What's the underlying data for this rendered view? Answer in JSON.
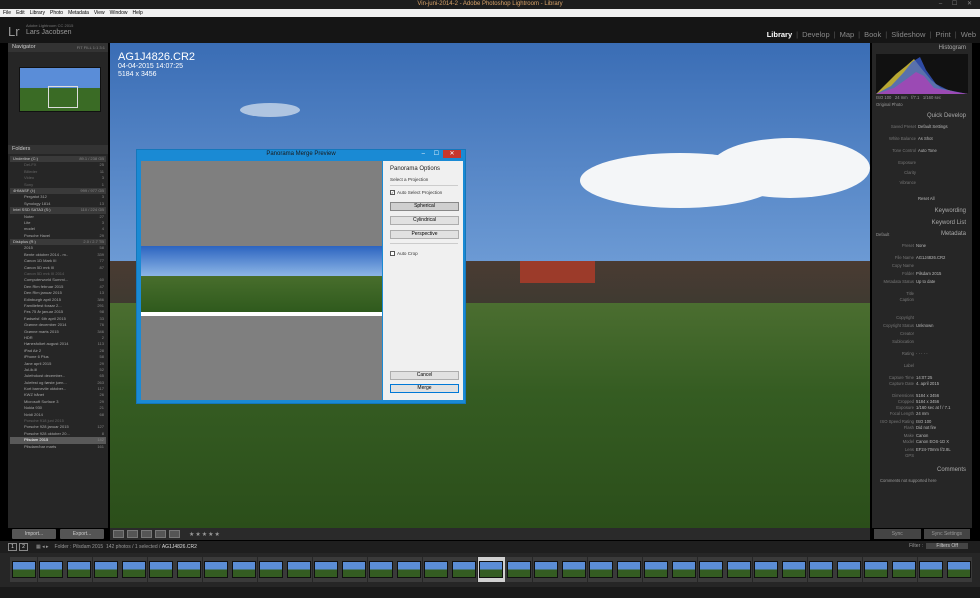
{
  "window": {
    "title": "Vin-juni-2014-2 - Adobe Photoshop Lightroom - Library",
    "controls": "– ☐ ✕"
  },
  "menubar": [
    "File",
    "Edit",
    "Library",
    "Photo",
    "Metadata",
    "View",
    "Window",
    "Help"
  ],
  "identity": {
    "logo": "Lr",
    "catalog": "Adobe Lightroom CC 2015",
    "user": "Lars Jacobsen"
  },
  "modules": [
    "Library",
    "Develop",
    "Map",
    "Book",
    "Slideshow",
    "Print",
    "Web"
  ],
  "active_module": "Library",
  "left": {
    "navigator": {
      "label": "Navigator",
      "zoom": "FIT FILL 1:1 3:1"
    },
    "folders": {
      "label": "Folders"
    },
    "items": [
      {
        "t": "vol",
        "label": "Underline (C:)",
        "n": "89.1 / 238 GB"
      },
      {
        "t": "dim",
        "label": "Del-FX",
        "n": "25"
      },
      {
        "t": "dim",
        "label": "Billeder",
        "n": "11"
      },
      {
        "t": "dim",
        "label": "Video",
        "n": "3"
      },
      {
        "t": "dim",
        "label": "Sony",
        "n": "1"
      },
      {
        "t": "vol",
        "label": "4HMASF (I:)",
        "n": "999 / 977 GB"
      },
      {
        "t": "",
        "label": "Pergatot 312",
        "n": "3"
      },
      {
        "t": "",
        "label": "Synology 1814",
        "n": "13"
      },
      {
        "t": "vol",
        "label": "Intel SSD SATA3 (S:)",
        "n": "110 / 224 GB"
      },
      {
        "t": "",
        "label": "Noter",
        "n": "27"
      },
      {
        "t": "",
        "label": "Lite",
        "n": "3"
      },
      {
        "t": "",
        "label": "model",
        "n": "4"
      },
      {
        "t": "",
        "label": "Porsche Havel",
        "n": "29"
      },
      {
        "t": "vol",
        "label": "Diskplus (R:)",
        "n": "2.0 / 2.7 TB"
      },
      {
        "t": "",
        "label": "2015",
        "n": "58"
      },
      {
        "t": "",
        "label": "Bente oktober 2014 - m..",
        "n": "339"
      },
      {
        "t": "",
        "label": "Canon 1D Mark III",
        "n": "77"
      },
      {
        "t": "",
        "label": "Canon 5D mrk III",
        "n": "87"
      },
      {
        "t": "dim",
        "label": "Canon 5D mrk III 2014",
        "n": ""
      },
      {
        "t": "",
        "label": "Computerworld Summi...",
        "n": "60"
      },
      {
        "t": "",
        "label": "Den Rim februar 2015",
        "n": "47"
      },
      {
        "t": "",
        "label": "Den Rim januar 2015",
        "n": "13"
      },
      {
        "t": "",
        "label": "Edinburgh april 2015",
        "n": "386"
      },
      {
        "t": "",
        "label": "Familiefest foraar 2...",
        "n": "291"
      },
      {
        "t": "",
        "label": "Fes 75 år januar 2015",
        "n": "98"
      },
      {
        "t": "",
        "label": "Fødselsf. 6th april 2015",
        "n": "33"
      },
      {
        "t": "",
        "label": "Grønne december 2014",
        "n": "76"
      },
      {
        "t": "",
        "label": "Grønne marts 2015",
        "n": "346"
      },
      {
        "t": "",
        "label": "HDR",
        "n": "2"
      },
      {
        "t": "",
        "label": "Hønesfolket august 2014",
        "n": "113"
      },
      {
        "t": "",
        "label": "iPad Air 2",
        "n": "28"
      },
      {
        "t": "",
        "label": "iPhone 6 Plus",
        "n": "58"
      },
      {
        "t": "",
        "label": "Jane april 2015",
        "n": "29"
      },
      {
        "t": "",
        "label": "Jul-ik.lil",
        "n": "52"
      },
      {
        "t": "",
        "label": "Julefrokost december...",
        "n": "65"
      },
      {
        "t": "",
        "label": "Julefest og første juen...",
        "n": "263"
      },
      {
        "t": "",
        "label": "Kort barnevile oktober...",
        "n": "117"
      },
      {
        "t": "",
        "label": "KWZ hånet",
        "n": "26"
      },
      {
        "t": "",
        "label": "Microsoft Surface 3",
        "n": "29"
      },
      {
        "t": "",
        "label": "Nokia 930",
        "n": "21"
      },
      {
        "t": "",
        "label": "Nvidi 2014",
        "n": "68"
      },
      {
        "t": "dim",
        "label": "Porsche 918 juni 2015",
        "n": ""
      },
      {
        "t": "",
        "label": "Porsche 928 januar 2015",
        "n": "127"
      },
      {
        "t": "",
        "label": "Porsche 928 oktober 20...",
        "n": "8"
      },
      {
        "t": "sel",
        "label": "Pilsdam 2015",
        "n": "142"
      },
      {
        "t": "",
        "label": "Pilsdam/bar marts",
        "n": "161"
      }
    ],
    "import_label": "Import...",
    "export_label": "Export..."
  },
  "photo_info": {
    "filename": "AG1J4826.CR2",
    "datetime": "04-04-2015 14:07:25",
    "dimensions": "5184 x 3456"
  },
  "toolbar": {
    "stars": "★★★★★"
  },
  "dialog": {
    "title": "Panorama Merge Preview",
    "options_title": "Panorama Options",
    "projection_label": "Select a Projection",
    "auto_select_label": "Auto Select Projection",
    "buttons": [
      "Spherical",
      "Cylindrical",
      "Perspective"
    ],
    "auto_crop_label": "Auto Crop",
    "cancel_label": "Cancel",
    "merge_label": "Merge"
  },
  "right": {
    "histogram_label": "Histogram",
    "histogram_info": [
      "ISO 100",
      "24 mm",
      "f/7.1",
      "1/160 sec"
    ],
    "original_photo": "Original Photo",
    "quick_develop": "Quick Develop",
    "qd": [
      {
        "k": "Saved Preset",
        "v": "Default Settings"
      },
      {
        "k": "White Balance",
        "v": "As Shot"
      },
      {
        "k": "Tone Control",
        "v": "Auto Tone"
      },
      {
        "k": "Exposure",
        "v": ""
      },
      {
        "k": "Clarity",
        "v": ""
      },
      {
        "k": "Vibrance",
        "v": ""
      },
      {
        "k": "",
        "v": "Reset All"
      }
    ],
    "keywording": "Keywording",
    "keyword_list": "Keyword List",
    "metadata": "Metadata",
    "metadata_preset": "Default",
    "meta": [
      {
        "k": "Preset",
        "v": "None"
      },
      {
        "k": "File Name",
        "v": "AG1J4826.CR2"
      },
      {
        "k": "Copy Name",
        "v": ""
      },
      {
        "k": "Folder",
        "v": "Pilsdam 2015"
      },
      {
        "k": "Metadata Status",
        "v": "Up to date"
      },
      {
        "k": "Title",
        "v": ""
      },
      {
        "k": "Caption",
        "v": ""
      },
      {
        "k": "Copyright",
        "v": ""
      },
      {
        "k": "Copyright Status",
        "v": "Unknown"
      },
      {
        "k": "Creator",
        "v": ""
      },
      {
        "k": "Sublocation",
        "v": ""
      },
      {
        "k": "Rating",
        "v": "· · · · ·"
      },
      {
        "k": "Label",
        "v": ""
      },
      {
        "k": "Capture Time",
        "v": "14:07:25"
      },
      {
        "k": "Capture Date",
        "v": "4. april 2015"
      },
      {
        "k": "Dimensions",
        "v": "5184 x 3456"
      },
      {
        "k": "Cropped",
        "v": "5184 x 3456"
      },
      {
        "k": "Exposure",
        "v": "1/160 sec at f / 7.1"
      },
      {
        "k": "Focal Length",
        "v": "24 mm"
      },
      {
        "k": "ISO Speed Rating",
        "v": "ISO 100"
      },
      {
        "k": "Flash",
        "v": "Did not fire"
      },
      {
        "k": "Make",
        "v": "Canon"
      },
      {
        "k": "Model",
        "v": "Canon EOS-1D X"
      },
      {
        "k": "Lens",
        "v": "EF24-70mm f/2.8L"
      },
      {
        "k": "GPS",
        "v": ""
      }
    ],
    "comments": "Comments",
    "comments_note": "Comments not supported here",
    "sync_label": "Sync",
    "sync_settings_label": "Sync Settings"
  },
  "filmstrip": {
    "pages": [
      "1",
      "2"
    ],
    "path": "Folder : Pilsdam 2015",
    "count": "142 photos / 1 selected /",
    "selected_file": "AG1J4826.CR2",
    "filter_label": "Filter :",
    "filter_value": "Filters Off"
  }
}
